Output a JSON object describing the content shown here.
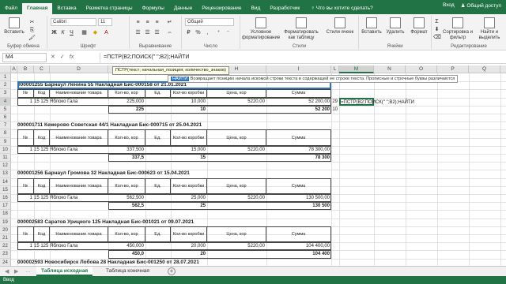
{
  "ribbon_tabs": [
    "Файл",
    "Главная",
    "Вставка",
    "Разметка страницы",
    "Формулы",
    "Данные",
    "Рецензирование",
    "Вид",
    "Разработчик"
  ],
  "active_tab": "Главная",
  "tell_me": "Что вы хотите сделать?",
  "user": {
    "login": "Вход",
    "share": "Общий доступ"
  },
  "ribbon": {
    "paste": "Вставить",
    "clipboard": "Буфер обмена",
    "font_name": "Calibri",
    "font_size": "11",
    "font": "Шрифт",
    "bold": "Ж",
    "italic": "К",
    "underline": "Ч",
    "alignment": "Выравнивание",
    "number_format": "Общий",
    "number": "Число",
    "cond_format": "Условное форматирование",
    "format_table": "Форматировать как таблицу",
    "cell_styles": "Стили ячеек",
    "styles": "Стили",
    "insert": "Вставить",
    "delete": "Удалить",
    "format": "Формат",
    "cells": "Ячейки",
    "sort": "Сортировка и фильтр",
    "find": "Найти и выделить",
    "editing": "Редактирование"
  },
  "formula_bar": {
    "name_box": "M4",
    "cancel": "✕",
    "enter": "✓",
    "fx": "fx",
    "content": "=ПСТР(B2;ПОИСК(\" \";B2);НАЙТИ"
  },
  "tooltip": {
    "signature": "ПСТР(текст; начальная_позиция; количество_знаков)",
    "fn_name": "НАЙТИ",
    "description": "Возвращает позицию начала искомой строки текста в содержащей ее строке текста. Прописные и строчные буквы различаются"
  },
  "columns": [
    "A",
    "B",
    "C",
    "D",
    "E",
    "F",
    "G",
    "H",
    "I",
    "J",
    "K",
    "L",
    "M",
    "N",
    "O",
    "P",
    "Q",
    "R"
  ],
  "rows": [
    "1",
    "2",
    "3",
    "4",
    "5",
    "6",
    "7",
    "8",
    "9",
    "10",
    "11",
    "12",
    "13",
    "14",
    "15",
    "16",
    "17",
    "18",
    "19",
    "20",
    "21",
    "22",
    "23",
    "24"
  ],
  "table_headers": {
    "num": "№",
    "code": "Код",
    "name": "Наименование товара",
    "qty": "Кол-во, кор",
    "unit": "Ед.",
    "boxes": "Кол-во коробки",
    "price": "Цена, кор",
    "sum": "Сумма"
  },
  "blocks": [
    {
      "title": "000001255 Барнаул Ленина 55 Накладная Бис-000158 от 21.01.2021",
      "row": {
        "num": "1",
        "code": "15 125",
        "name": "Яблоко Гала",
        "qty": "225,000",
        "boxes": "10,000",
        "price": "5220,00",
        "sum": "52 200,00"
      },
      "total": {
        "qty": "225",
        "boxes": "10",
        "sum": "52 200"
      }
    },
    {
      "title": "000001711 Кемерово Советская 44/1 Накладная Бис-000715 от 25.04.2021",
      "row": {
        "num": "1",
        "code": "15 125",
        "name": "Яблоко Гала",
        "qty": "337,500",
        "boxes": "15,000",
        "price": "5220,00",
        "sum": "78 300,00"
      },
      "total": {
        "qty": "337,5",
        "boxes": "15",
        "sum": "78 300"
      }
    },
    {
      "title": "000001256 Барнаул Громова 32 Накладная Бис-000623 от 15.04.2021",
      "row": {
        "num": "1",
        "code": "15 125",
        "name": "Яблоко Гала",
        "qty": "562,500",
        "boxes": "25,000",
        "price": "5220,00",
        "sum": "130 500,00"
      },
      "total": {
        "qty": "562,5",
        "boxes": "25",
        "sum": "130 500"
      }
    },
    {
      "title": "000002583 Саратов Урицкого 125 Накладная Бис-001021 от 09.07.2021",
      "row": {
        "num": "1",
        "code": "15 125",
        "name": "Яблоко Гала",
        "qty": "450,000",
        "boxes": "20,000",
        "price": "5220,00",
        "sum": "104 400,00"
      },
      "total": {
        "qty": "450,0",
        "boxes": "20",
        "sum": "104 400"
      }
    },
    {
      "title": "000002593 Новосибирск Лобова 28 Накладная Бис-001250 от 28.07.2021"
    }
  ],
  "side_values": {
    "l4": "29",
    "m4": "=ПСТР(B2;ПОИСК(\" \";B2);НАЙТИ",
    "l5": "10"
  },
  "sheets": [
    "Таблица исходная",
    "Таблица конечная"
  ],
  "active_sheet": "Таблица исходная",
  "status": "Ввод"
}
